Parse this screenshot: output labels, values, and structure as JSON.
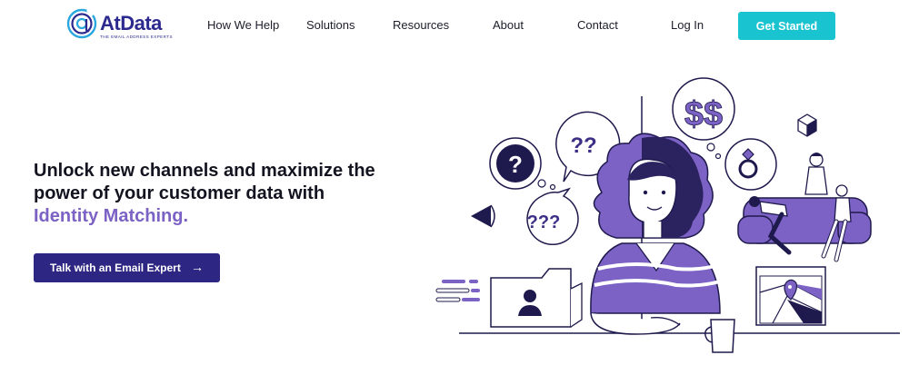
{
  "brand": {
    "name": "AtData",
    "tagline": "THE EMAIL ADDRESS EXPERTS"
  },
  "nav": {
    "items": [
      {
        "label": "How We Help"
      },
      {
        "label": "Solutions"
      },
      {
        "label": "Resources"
      },
      {
        "label": "About"
      },
      {
        "label": "Contact"
      },
      {
        "label": "Log In"
      }
    ],
    "cta_label": "Get Started"
  },
  "hero": {
    "title_line1": "Unlock new channels and maximize the",
    "title_line2": "power of your customer data with",
    "title_accent": "Identity Matching.",
    "cta_label": "Talk with an Email Expert",
    "cta_arrow": "→"
  },
  "illustration": {
    "bubble_question": "?",
    "bubble_double": "??",
    "bubble_triple": "???",
    "bubble_money": "$$"
  },
  "colors": {
    "accent_teal": "#19c3cf",
    "primary_navy": "#2e2683",
    "accent_purple": "#7b62c4",
    "logo_blue": "#2d2a8f",
    "logo_cyan": "#2aa7df"
  }
}
